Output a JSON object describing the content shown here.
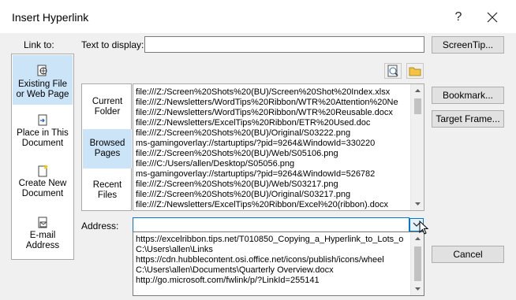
{
  "window": {
    "title": "Insert Hyperlink",
    "help_glyph": "?"
  },
  "link_to": {
    "label": "Link to:",
    "items": [
      {
        "line1": "Existing File",
        "line2": "or Web Page",
        "selected": true,
        "icon": "globe-document-icon"
      },
      {
        "line1": "Place in This",
        "line2": "Document",
        "selected": false,
        "icon": "document-arrow-icon"
      },
      {
        "line1": "Create New",
        "line2": "Document",
        "selected": false,
        "icon": "new-document-icon"
      },
      {
        "line1": "E-mail",
        "line2": "Address",
        "selected": false,
        "icon": "mail-icon"
      }
    ]
  },
  "text_to_display": {
    "label": "Text to display:",
    "value": ""
  },
  "screentip_label": "ScreenTip...",
  "look_in": {
    "items": [
      {
        "line1": "Current",
        "line2": "Folder",
        "selected": false
      },
      {
        "line1": "Browsed",
        "line2": "Pages",
        "selected": true
      },
      {
        "line1": "Recent",
        "line2": "Files",
        "selected": false
      }
    ],
    "files": [
      "file:///Z:/Screen%20Shots%20(BU)/Screen%20Shot%20Index.xlsx",
      "file:///Z:/Newsletters/WordTips%20Ribbon/WTR%20Attention%20Ne",
      "file:///Z:/Newsletters/WordTips%20Ribbon/WTR%20Reusable.docx",
      "file:///Z:/Newsletters/ExcelTips%20Ribbon/ETR%20Used.doc",
      "file:///Z:/Screen%20Shots%20(BU)/Original/S03222.png",
      "ms-gamingoverlay://startuptips/?pid=9264&WindowId=330220",
      "file:///Z:/Screen%20Shots%20(BU)/Web/S05106.png",
      "file:///C:/Users/allen/Desktop/S05056.png",
      "ms-gamingoverlay://startuptips/?pid=9264&WindowId=526782",
      "file:///Z:/Screen%20Shots%20(BU)/Web/S03217.png",
      "file:///Z:/Screen%20Shots%20(BU)/Original/S03217.png",
      "file:///Z:/Newsletters/ExcelTips%20Ribbon/Excel%20(ribbon).docx"
    ]
  },
  "buttons": {
    "bookmark": "Bookmark...",
    "target_frame": "Target Frame...",
    "cancel": "Cancel"
  },
  "address": {
    "label": "Address:",
    "value": "",
    "suggestions": [
      "https://excelribbon.tips.net/T010850_Copying_a_Hyperlink_to_Lots_o",
      "C:\\Users\\allen\\Links",
      "https://cdn.hubblecontent.osi.office.net/icons/publish/icons/wheel",
      "C:\\Users\\allen\\Documents\\Quarterly Overview.docx",
      "http://go.microsoft.com/fwlink/p/?LinkId=255141"
    ]
  },
  "colors": {
    "selection": "#cce4f7",
    "accent": "#0078d7",
    "dialog_bg": "#f0f0f0"
  }
}
